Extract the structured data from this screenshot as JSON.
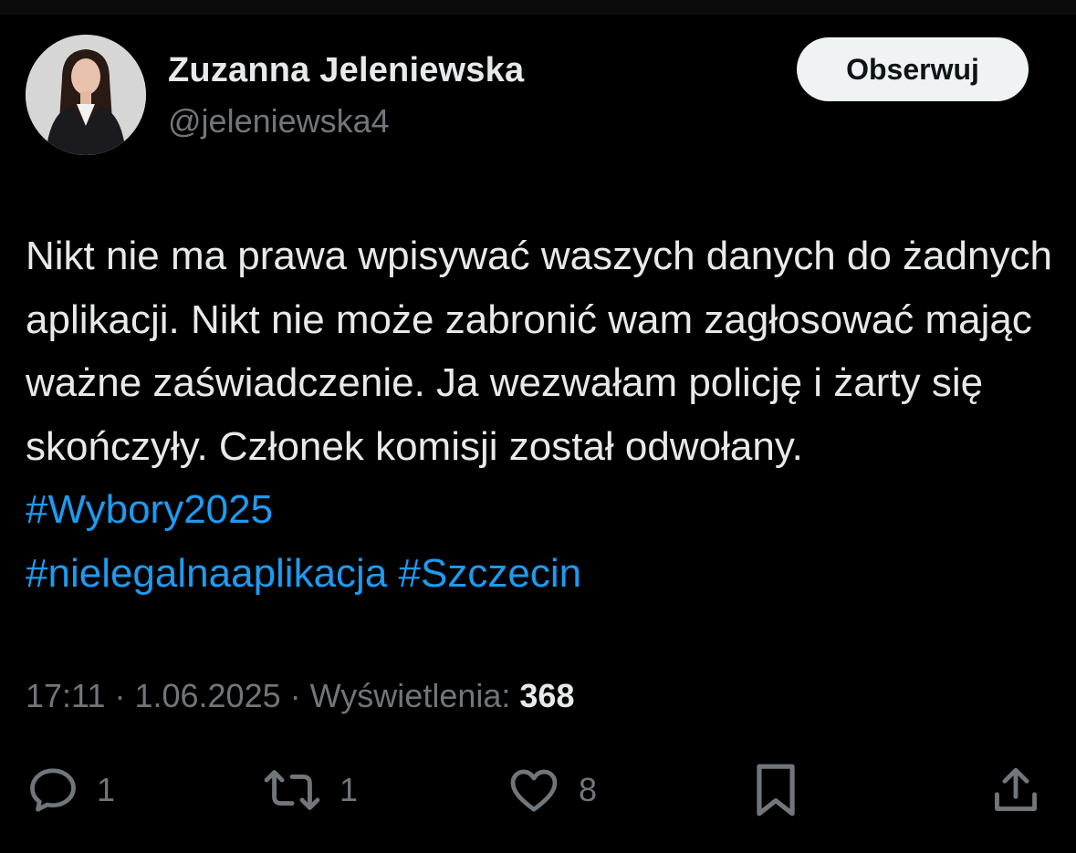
{
  "author": {
    "name": "Zuzanna Jeleniewska",
    "handle": "@jeleniewska4",
    "avatar_icon": "profile-photo"
  },
  "follow_label": "Obserwuj",
  "tweet": {
    "text": "Nikt nie ma prawa wpisywać waszych danych do żadnych aplikacji. Nikt nie może zabronić wam zagłosować mając ważne zaświadczenie. Ja wezwałam policję i żarty się skończyły. Członek komisji został odwołany.",
    "hashtags": [
      "#Wybory2025",
      "#nielegalnaaplikacja",
      "#Szczecin"
    ]
  },
  "meta": {
    "time": "17:11",
    "date": "1.06.2025",
    "views_label": "Wyświetlenia:",
    "views_count": "368",
    "separator": "·"
  },
  "actions": {
    "reply_count": "1",
    "retweet_count": "1",
    "like_count": "8"
  },
  "colors": {
    "background": "#000000",
    "text": "#e7e9ea",
    "secondary": "#71767b",
    "hashtag": "#1d9bf0",
    "button_bg": "#eff3f4"
  }
}
